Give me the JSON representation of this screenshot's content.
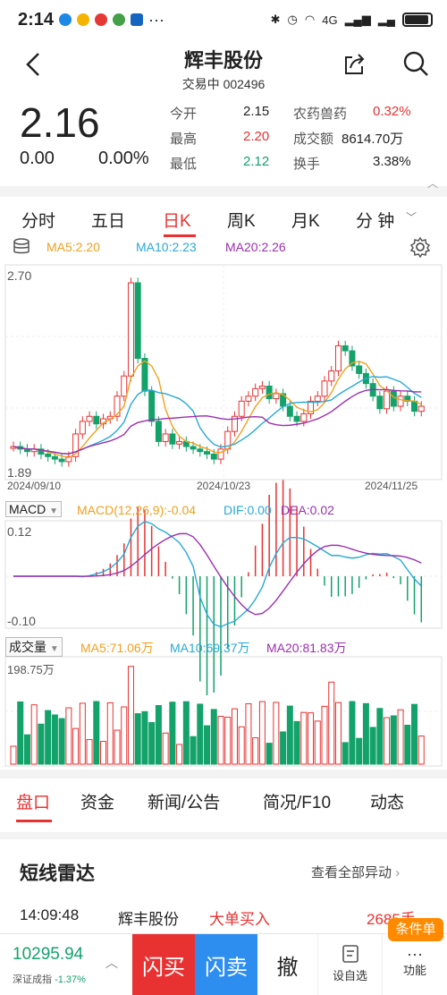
{
  "status": {
    "time": "2:14",
    "net": "4G"
  },
  "header": {
    "title": "辉丰股份",
    "subtitle": "交易中 002496"
  },
  "quote": {
    "price": "2.16",
    "change": "0.00",
    "change_pct": "0.00%",
    "open_lbl": "今开",
    "open": "2.15",
    "high_lbl": "最高",
    "high": "2.20",
    "low_lbl": "最低",
    "low": "2.12",
    "sector_lbl": "农药兽药",
    "sector_chg": "0.32%",
    "amount_lbl": "成交额",
    "amount": "8614.70万",
    "turnover_lbl": "换手",
    "turnover": "3.38%"
  },
  "tabs": [
    "分时",
    "五日",
    "日K",
    "周K",
    "月K",
    "分 钟"
  ],
  "kline": {
    "ma5": "MA5:2.20",
    "ma10": "MA10:2.23",
    "ma20": "MA20:2.26",
    "ymax": "2.70",
    "ymin": "1.89",
    "dates": [
      "2024/09/10",
      "2024/10/23",
      "2024/11/25"
    ]
  },
  "macd": {
    "selector": "MACD",
    "macd": "MACD(12,26,9):-0.04",
    "dif": "DIF:0.00",
    "dea": "DEA:0.02",
    "ymax": "0.12",
    "ymin": "-0.10"
  },
  "volume": {
    "selector": "成交量",
    "ma5": "MA5:71.06万",
    "ma10": "MA10:69.37万",
    "ma20": "MA20:81.83万",
    "ymax": "198.75万"
  },
  "chart_data": {
    "type": "candlestick",
    "title": "",
    "ylim": [
      1.89,
      2.7
    ],
    "categories": [
      "2024/09/10",
      "2024/10/23",
      "2024/11/25"
    ],
    "colors": {
      "up": "#e83232",
      "down": "#13a26a",
      "ma5": "#f0a020",
      "ma10": "#27a9d8",
      "ma20": "#9b2fae"
    }
  },
  "bottom_tabs": [
    "盘口",
    "资金",
    "新闻/公告",
    "简况/F10",
    "动态"
  ],
  "radar": {
    "title": "短线雷达",
    "more": "查看全部异动",
    "time": "14:09:48",
    "name": "辉丰股份",
    "event": "大单买入",
    "value": "2685手"
  },
  "footer": {
    "index_value": "10295.94",
    "index_label": "深证成指",
    "index_chg": "-1.37%",
    "flash_buy": "闪买",
    "flash_sell": "闪卖",
    "cancel": "撤",
    "watch": "设自选",
    "func": "功能",
    "cond": "条件单"
  }
}
